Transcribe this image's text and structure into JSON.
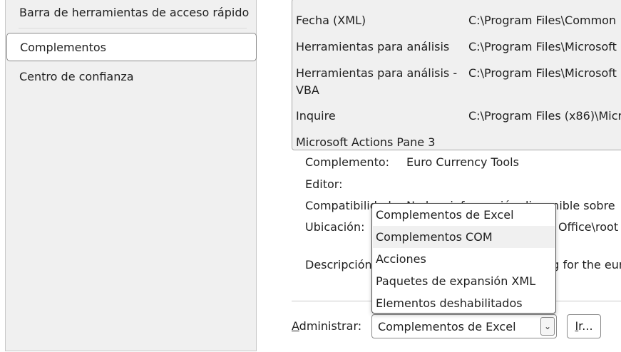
{
  "sidebar": {
    "items": [
      {
        "label": "Barra de herramientas de acceso rápido"
      },
      {
        "label": "Complementos"
      },
      {
        "label": "Centro de confianza"
      }
    ]
  },
  "addins": {
    "rows": [
      {
        "name": "Fecha (XML)",
        "location": "C:\\Program Files\\Common"
      },
      {
        "name": "Herramientas para análisis",
        "location": "C:\\Program Files\\Microsoft"
      },
      {
        "name": "Herramientas para análisis - VBA",
        "location": "C:\\Program Files\\Microsoft"
      },
      {
        "name": "Inquire",
        "location": "C:\\Program Files (x86)\\Micr"
      },
      {
        "name": "Microsoft Actions Pane 3",
        "location": ""
      }
    ]
  },
  "details": {
    "complemento_label": "Complemento:",
    "complemento_value": "Euro Currency Tools",
    "editor_label": "Editor:",
    "editor_value": "",
    "compat_label": "Compatibilidad:",
    "compat_value": "No hay información disponible sobre",
    "ubicacion_label": "Ubicación:",
    "ubicacion_value": "C:\\Program Files\\Microsoft Office\\root",
    "descripcion_label": "Descripción:",
    "descripcion_value": "Conversion and formatting for the euro"
  },
  "manage": {
    "label_accel": "A",
    "label_rest": "dministrar:",
    "selected": "Complementos de Excel",
    "go_accel": "I",
    "go_rest": "r..."
  },
  "dropdown": {
    "options": [
      {
        "label": "Complementos de Excel"
      },
      {
        "label": "Complementos COM"
      },
      {
        "label": "Acciones"
      },
      {
        "label": "Paquetes de expansión XML"
      },
      {
        "label": "Elementos deshabilitados"
      }
    ]
  }
}
